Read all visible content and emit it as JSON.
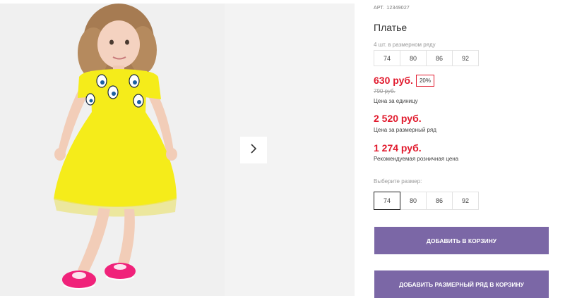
{
  "product": {
    "art_label": "АРТ.",
    "art_number": "12349027",
    "title": "Платье"
  },
  "pack": {
    "label": "4 шт. в размерном ряду",
    "sizes": [
      "74",
      "80",
      "86",
      "92"
    ]
  },
  "prices": {
    "unit_price": "630 руб.",
    "discount": "20%",
    "old_price": "790 руб.",
    "unit_caption": "Цена за единицу",
    "pack_price": "2 520 руб.",
    "pack_caption": "Цена за размерный ряд",
    "retail_price": "1 274 руб.",
    "retail_caption": "Рекомендуемая розничная цена"
  },
  "size_select": {
    "label": "Выберите размер:",
    "options": [
      "74",
      "80",
      "86",
      "92"
    ],
    "selected": "74"
  },
  "buttons": {
    "add_to_cart": "ДОБАВИТЬ В КОРЗИНУ",
    "add_pack_to_cart": "ДОБАВИТЬ РАЗМЕРНЫЙ РЯД В КОРЗИНУ"
  },
  "colors": {
    "price_red": "#e11b2e",
    "button_purple": "#7b67a6",
    "dress_yellow": "#f5ec1a",
    "shoe_pink": "#f0227a"
  },
  "icons": {
    "next": "chevron-right-icon"
  }
}
